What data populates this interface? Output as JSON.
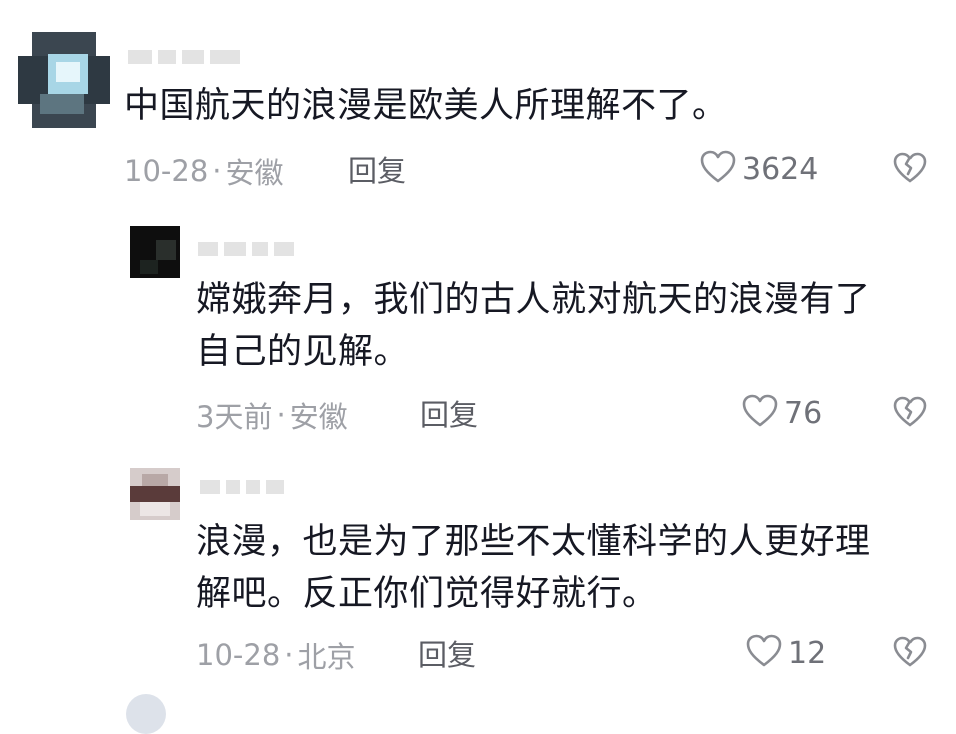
{
  "comments": [
    {
      "text_lines": [
        "中国航天的浪漫是欧美人所理解不了。"
      ],
      "date": "10-28",
      "location": "安徽",
      "reply_label": "回复",
      "likes": "3624"
    },
    {
      "text_lines": [
        "嫦娥奔月，我们的古人就对航天的浪漫有了",
        "自己的见解。"
      ],
      "date": "3天前",
      "location": "安徽",
      "reply_label": "回复",
      "likes": "76"
    },
    {
      "text_lines": [
        "浪漫，也是为了那些不太懂科学的人更好理",
        "解吧。反正你们觉得好就行。"
      ],
      "date": "10-28",
      "location": "北京",
      "reply_label": "回复",
      "likes": "12"
    }
  ],
  "meta_separator": "·",
  "icons": {
    "like": "heart-outline-icon",
    "dislike": "broken-heart-icon"
  },
  "colors": {
    "text": "#161823",
    "meta": "#9ea0a6",
    "reply": "#5b5d64"
  }
}
